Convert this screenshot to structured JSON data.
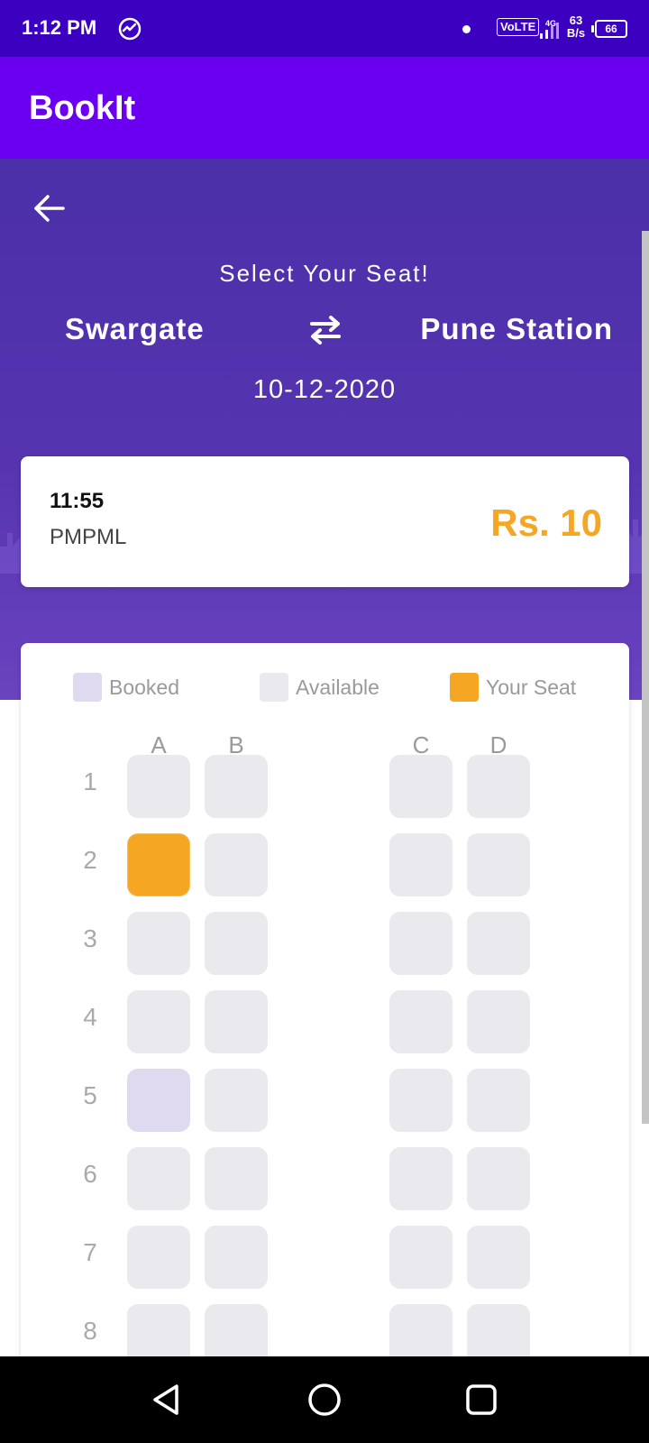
{
  "status_bar": {
    "time": "1:12 PM",
    "volte": "VoLTE",
    "network": "4G",
    "speed_value": "63",
    "speed_unit": "B/s",
    "battery": "66"
  },
  "app_bar": {
    "title": "BookIt"
  },
  "hero": {
    "subtitle": "Select Your Seat!",
    "from": "Swargate",
    "to": "Pune Station",
    "date": "10-12-2020"
  },
  "trip": {
    "time": "11:55",
    "operator": "PMPML",
    "price": "Rs. 10"
  },
  "legend": {
    "booked": "Booked",
    "available": "Available",
    "your_seat": "Your Seat"
  },
  "seat_map": {
    "columns": [
      "A",
      "B",
      "C",
      "D"
    ],
    "rows": [
      "1",
      "2",
      "3",
      "4",
      "5",
      "6",
      "7",
      "8"
    ],
    "selected": [
      "2A"
    ],
    "booked": [
      "5A"
    ]
  },
  "colors": {
    "status_bar": "#3c00c0",
    "app_bar": "#6a00ef",
    "accent_price": "#f5a623",
    "seat_available": "#e9e9ee",
    "seat_booked": "#e0daf0",
    "seat_yours": "#f5a623"
  },
  "icons": {
    "back": "arrow-left-icon",
    "swap": "swap-arrows-icon",
    "nav_back": "triangle-back-icon",
    "nav_home": "circle-home-icon",
    "nav_recents": "square-recents-icon"
  }
}
